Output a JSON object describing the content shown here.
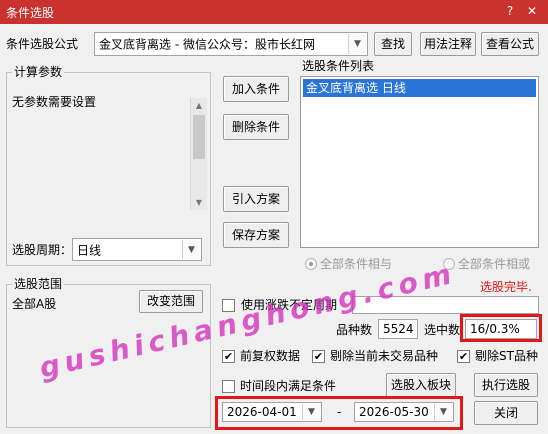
{
  "window": {
    "title": "条件选股",
    "help_icon": "?",
    "close_icon": "✕"
  },
  "formula": {
    "label": "条件选股公式",
    "value": "金叉底背离选  -  微信公众号：股市长红网",
    "buttons": {
      "find": "查找",
      "usage": "用法注释",
      "view": "查看公式"
    }
  },
  "params": {
    "title": "计算参数",
    "text": "无参数需要设置"
  },
  "period": {
    "label": "选股周期：",
    "value": "日线"
  },
  "actions": {
    "add": "加入条件",
    "delete": "删除条件",
    "import": "引入方案",
    "save": "保存方案"
  },
  "condition_list": {
    "title": "选股条件列表",
    "items": [
      "金叉底背离选  日线"
    ]
  },
  "logic": {
    "and_label": "全部条件相与",
    "or_label": "全部条件相或"
  },
  "status": {
    "done": "选股完毕."
  },
  "scope": {
    "title": "选股范围",
    "value": "全部A股",
    "change_button": "改变范围"
  },
  "options": {
    "use_change_period": {
      "label": "使用涨跌不定周期",
      "checked": false
    },
    "count_label": "品种数",
    "count_value": "5524",
    "selected_label": "选中数",
    "selected_value": "16/0.3%",
    "forward_adjust": {
      "label": "前复权数据",
      "checked": true
    },
    "exclude_untraded": {
      "label": "剔除当前未交易品种",
      "checked": true
    },
    "exclude_st": {
      "label": "剔除ST品种",
      "checked": true
    },
    "time_range": {
      "label": "时间段内满足条件",
      "checked": false
    }
  },
  "date_range": {
    "start": "2026-04-01",
    "separator": "-",
    "end": "2026-05-30"
  },
  "bottom_buttons": {
    "to_block": "选股入板块",
    "run": "执行选股",
    "close": "关闭"
  },
  "watermark": "gushichanghong.com",
  "colors": {
    "title_bar": "#c9322f",
    "selection": "#2a74d6",
    "status_red": "#e01818",
    "watermark": "#d52dbe"
  }
}
